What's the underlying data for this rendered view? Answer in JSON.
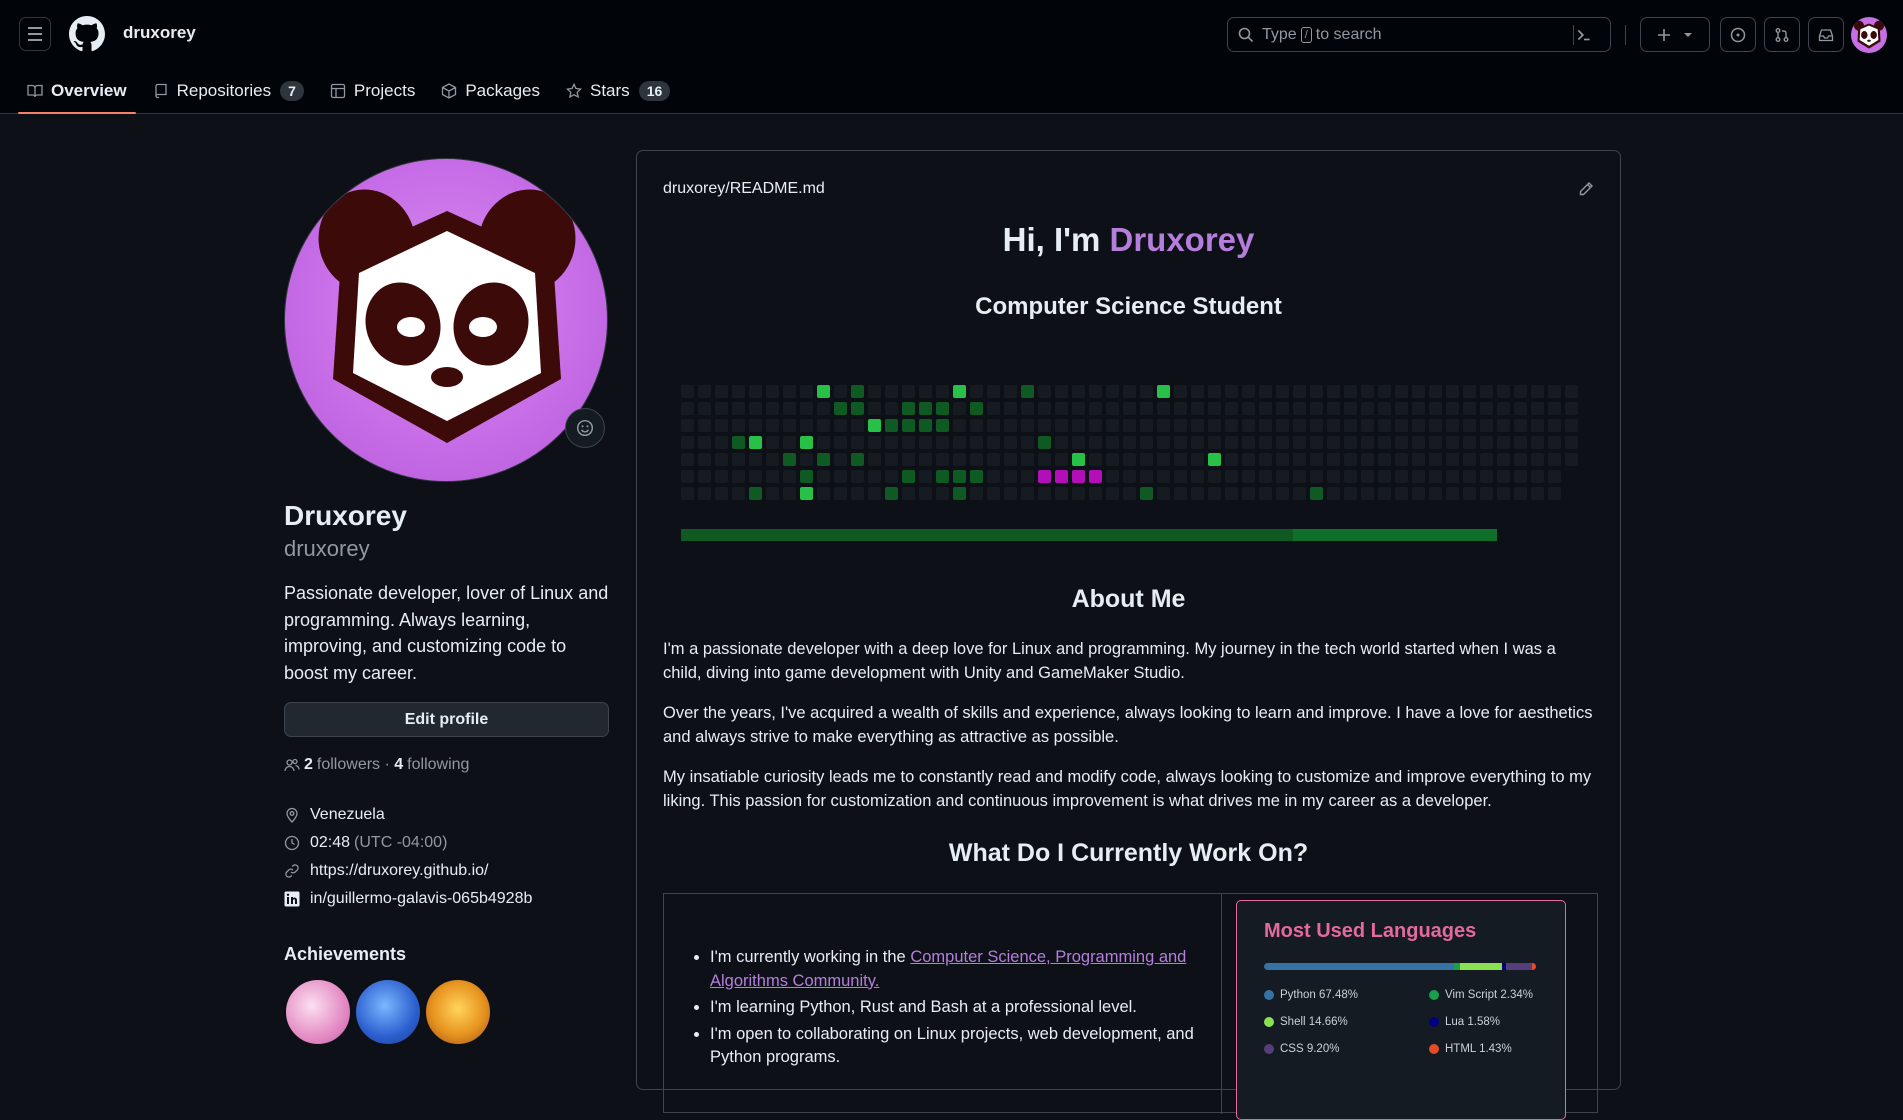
{
  "header": {
    "owner": "druxorey",
    "search_placeholder_prefix": "Type",
    "search_key": "/",
    "search_placeholder_suffix": "to search"
  },
  "tabs": [
    {
      "label": "Overview",
      "icon": "book-icon",
      "active": true
    },
    {
      "label": "Repositories",
      "count": "7",
      "icon": "repo-icon"
    },
    {
      "label": "Projects",
      "icon": "table-icon"
    },
    {
      "label": "Packages",
      "icon": "package-icon"
    },
    {
      "label": "Stars",
      "count": "16",
      "icon": "star-icon"
    }
  ],
  "profile": {
    "name": "Druxorey",
    "login": "druxorey",
    "bio": "Passionate developer, lover of Linux and programming. Always learning, improving, and customizing code to boost my career.",
    "edit_label": "Edit profile",
    "followers_count": "2",
    "followers_label": "followers",
    "following_count": "4",
    "following_label": "following",
    "location": "Venezuela",
    "time": "02:48",
    "timezone": "(UTC -04:00)",
    "website": "https://druxorey.github.io/",
    "linkedin": "in/guillermo-galavis-065b4928b",
    "achievements_title": "Achievements"
  },
  "readme": {
    "path_user": "druxorey",
    "path_sep": "/",
    "path_file": "README.md",
    "greeting": "Hi, I'm ",
    "greeting_name": "Druxorey",
    "subtitle": "Computer Science Student",
    "about_title": "About Me",
    "about_p1": "I'm a passionate developer with a deep love for Linux and programming. My journey in the tech world started when I was a child, diving into game development with Unity and GameMaker Studio.",
    "about_p2": "Over the years, I've acquired a wealth of skills and experience, always looking to learn and improve. I have a love for aesthetics and always strive to make everything as attractive as possible.",
    "about_p3": "My insatiable curiosity leads me to constantly read and modify code, always looking to customize and improve everything to my liking. This passion for customization and continuous improvement is what drives me in my career as a developer.",
    "work_title": "What Do I Currently Work On?",
    "work_items": [
      {
        "prefix": "I'm currently working in the ",
        "link": "Computer Science, Programming and Algorithms Community.",
        "suffix": ""
      },
      {
        "prefix": "I'm learning Python, Rust and Bash at a professional level.",
        "link": "",
        "suffix": ""
      },
      {
        "prefix": "I'm open to collaborating on Linux projects, web development, and Python programs.",
        "link": "",
        "suffix": ""
      }
    ],
    "languages": {
      "title": "Most Used Languages",
      "items": [
        {
          "name": "Python",
          "percent": "67.48%",
          "value": 67.48,
          "color": "#3572a5"
        },
        {
          "name": "Vim Script",
          "percent": "2.34%",
          "value": 2.34,
          "color": "#199f4b"
        },
        {
          "name": "Shell",
          "percent": "14.66%",
          "value": 14.66,
          "color": "#89e051"
        },
        {
          "name": "Lua",
          "percent": "1.58%",
          "value": 1.58,
          "color": "#000080"
        },
        {
          "name": "CSS",
          "percent": "9.20%",
          "value": 9.2,
          "color": "#563d7c"
        },
        {
          "name": "HTML",
          "percent": "1.43%",
          "value": 1.43,
          "color": "#e34c26"
        }
      ]
    }
  },
  "colors": {
    "accent": "#b57edc",
    "tab_underline": "#f78166",
    "card_border": "#e4699e",
    "avatar_bg": "#c66be6",
    "contrib_bright": "#26c146",
    "contrib_dim": "#0e5a22",
    "contrib_pink": "#b30fb8"
  }
}
